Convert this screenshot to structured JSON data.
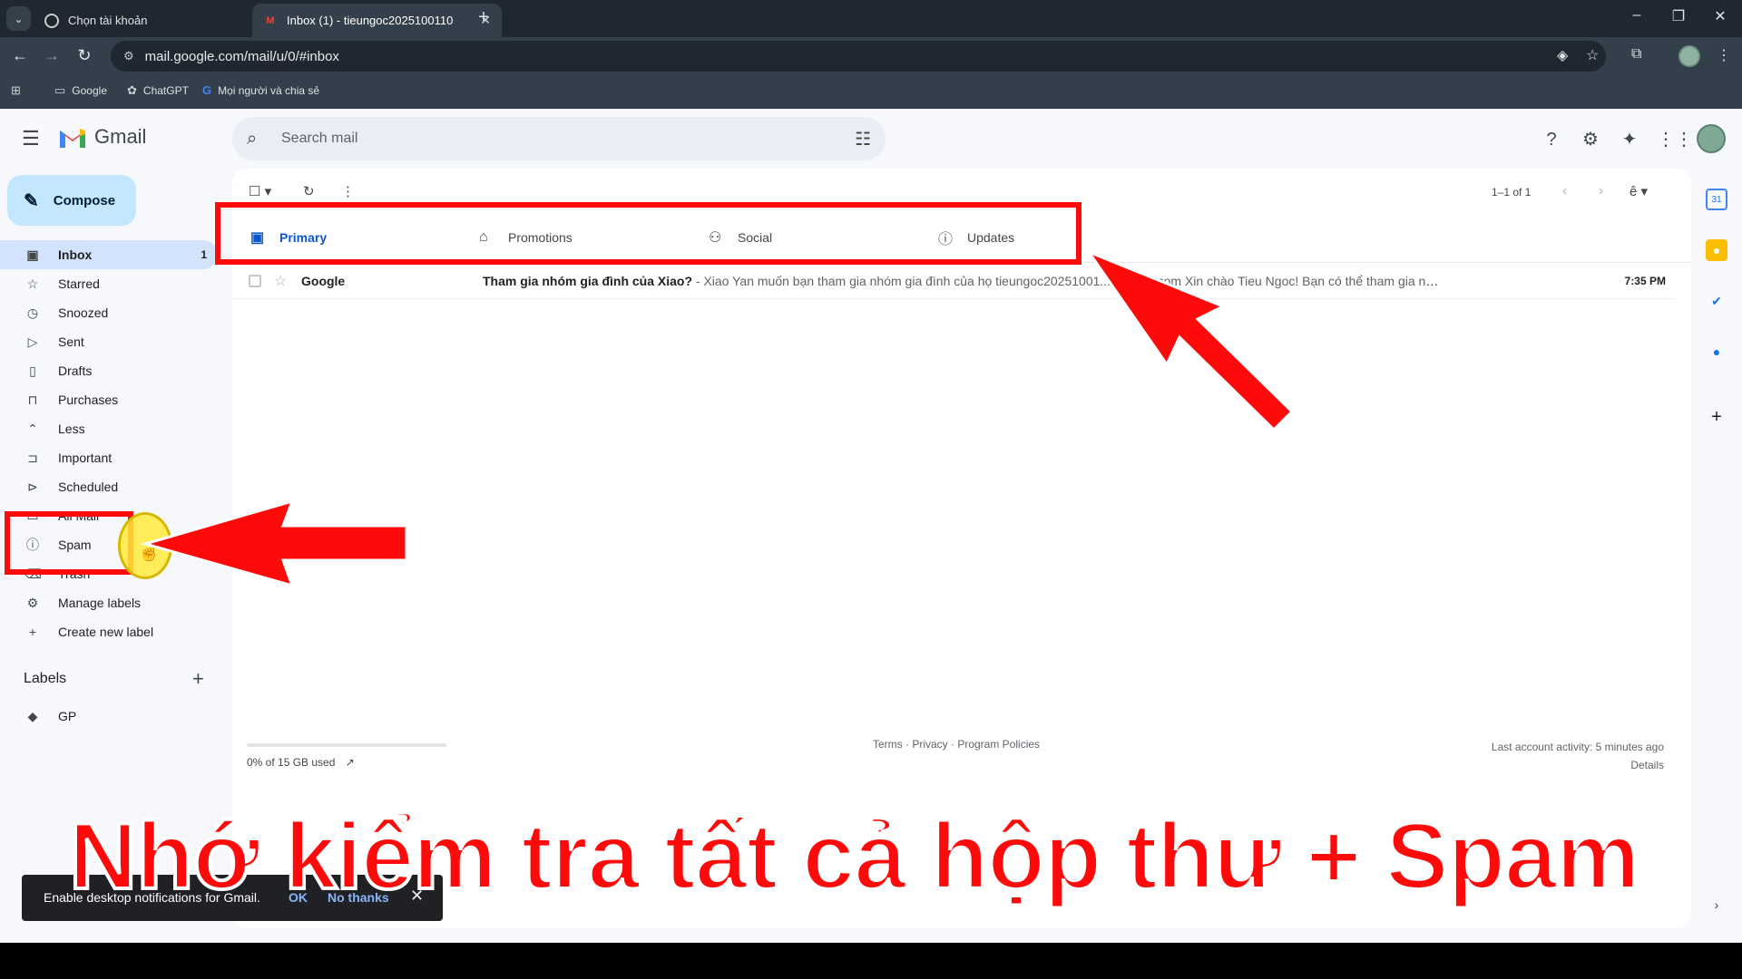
{
  "browser": {
    "tabs": [
      {
        "title": "Chọn tài khoản",
        "close": "✕"
      },
      {
        "title": "Inbox (1) - tieungoc2025100110",
        "close": "✕"
      }
    ],
    "new_tab": "+",
    "url": "mail.google.com/mail/u/0/#inbox",
    "bookmarks": [
      {
        "label": "Google",
        "icon": "folder-icon"
      },
      {
        "label": "ChatGPT",
        "icon": "chatgpt-icon"
      },
      {
        "label": "Mọi người và chia sẻ",
        "icon": "google-g-icon"
      }
    ]
  },
  "gmail": {
    "logo_text": "Gmail",
    "search_placeholder": "Search mail",
    "compose_label": "Compose",
    "nav": [
      {
        "label": "Inbox",
        "count": "1",
        "icon": "inbox-icon",
        "glyph": "▣",
        "active": true
      },
      {
        "label": "Starred",
        "count": "",
        "icon": "star-icon",
        "glyph": "☆"
      },
      {
        "label": "Snoozed",
        "count": "",
        "icon": "clock-icon",
        "glyph": "◷"
      },
      {
        "label": "Sent",
        "count": "",
        "icon": "send-icon",
        "glyph": "▷"
      },
      {
        "label": "Drafts",
        "count": "",
        "icon": "draft-icon",
        "glyph": "▯"
      },
      {
        "label": "Purchases",
        "count": "",
        "icon": "bag-icon",
        "glyph": "⊓"
      },
      {
        "label": "Less",
        "count": "",
        "icon": "chevron-up-icon",
        "glyph": "⌃"
      },
      {
        "label": "Important",
        "count": "",
        "icon": "important-icon",
        "glyph": "⊐"
      },
      {
        "label": "Scheduled",
        "count": "",
        "icon": "scheduled-icon",
        "glyph": "⊳"
      },
      {
        "label": "All Mail",
        "count": "",
        "icon": "all-mail-icon",
        "glyph": "▭"
      },
      {
        "label": "Spam",
        "count": "",
        "icon": "spam-icon",
        "glyph": "ⓘ"
      },
      {
        "label": "Trash",
        "count": "",
        "icon": "trash-icon",
        "glyph": "⌫"
      },
      {
        "label": "Manage labels",
        "count": "",
        "icon": "gear-icon",
        "glyph": "⚙"
      },
      {
        "label": "Create new label",
        "count": "",
        "icon": "plus-icon",
        "glyph": "+"
      }
    ],
    "labels_title": "Labels",
    "labels": [
      {
        "label": "GP",
        "icon": "label-icon",
        "glyph": "◆"
      }
    ],
    "pager": "1–1 of 1",
    "categories": [
      {
        "label": "Primary",
        "icon": "inbox-icon",
        "glyph": "▣"
      },
      {
        "label": "Promotions",
        "icon": "tag-icon",
        "glyph": "⌂"
      },
      {
        "label": "Social",
        "icon": "people-icon",
        "glyph": "⚇"
      },
      {
        "label": "Updates",
        "icon": "info-icon",
        "glyph": "ⓘ"
      }
    ],
    "emails": [
      {
        "sender": "Google",
        "subject": "Tham gia nhóm gia đình của Xiao?",
        "snippet": " - Xiao Yan muốn bạn tham gia nhóm gia đình của họ tieungoc20251001...@gmail.com Xin chào Tieu Ngoc! Bạn có thể tham gia nhóm gia đình của Xi...",
        "time": "7:35 PM"
      }
    ],
    "storage": "0% of 15 GB used",
    "storage_fraction": 0.0,
    "footer_links": "Terms · Privacy · Program Policies",
    "last_activity": "Last account activity: 5 minutes ago",
    "details": "Details"
  },
  "snackbar": {
    "text": "Enable desktop notifications for Gmail.",
    "ok": "OK",
    "no_thanks": "No thanks",
    "close": "✕"
  },
  "overlay": {
    "caption": "Nhớ kiểm tra tất cả hộp thư + Spam",
    "accent_color": "#ff0a0a"
  }
}
